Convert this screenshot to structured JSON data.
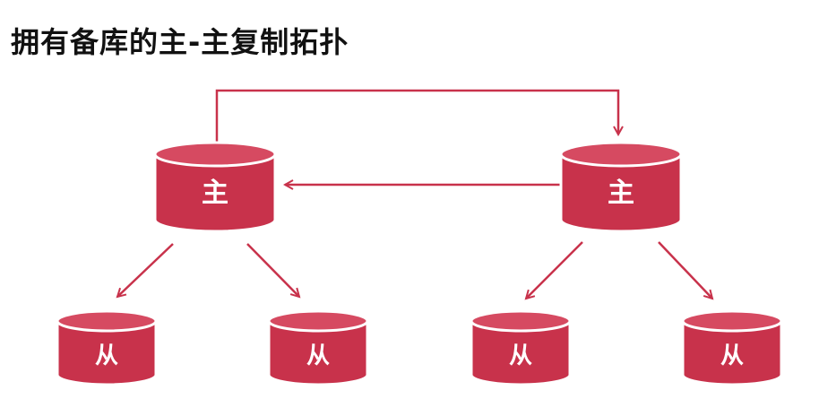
{
  "title": "拥有备库的主-主复制拓扑",
  "colors": {
    "node_fill": "#c8324b",
    "node_top": "#d64a61",
    "node_stroke": "#ffffff",
    "arrow": "#c8324b"
  },
  "nodes": {
    "master_left": "主",
    "master_right": "主",
    "slave_1": "从",
    "slave_2": "从",
    "slave_3": "从",
    "slave_4": "从"
  }
}
